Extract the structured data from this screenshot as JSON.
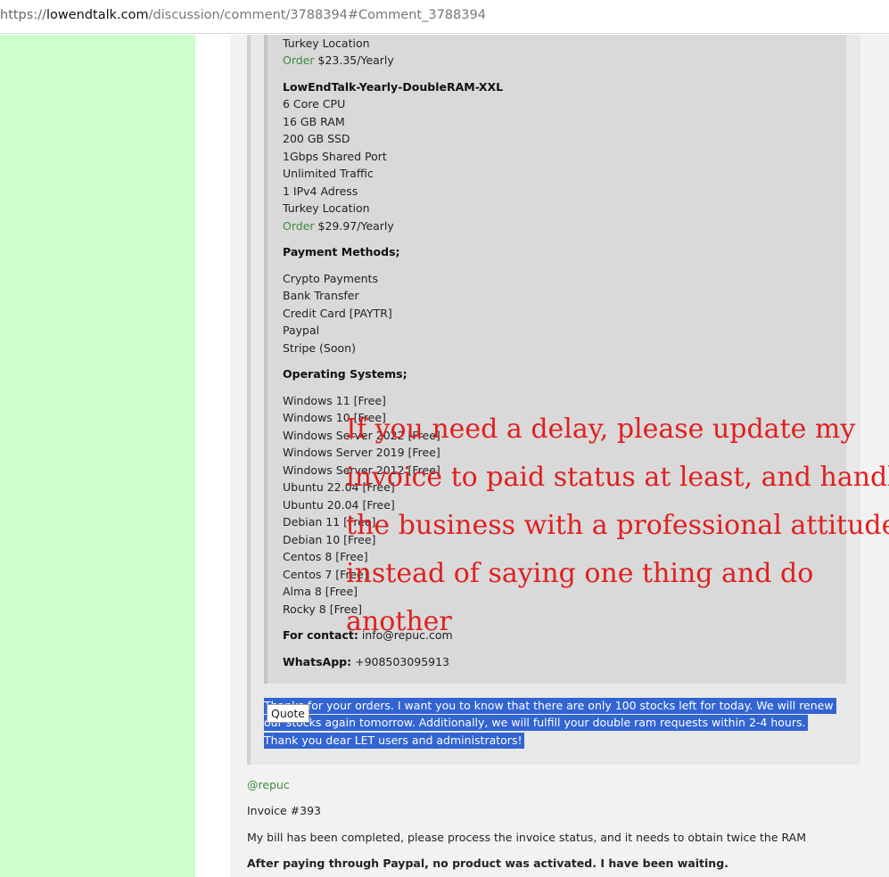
{
  "browser": {
    "url_scheme": "https://",
    "url_host": "lowendtalk.com",
    "url_path": "/discussion/comment/3788394#Comment_3788394"
  },
  "plan_prev": {
    "location": "Turkey Location",
    "order_label": "Order",
    "price": "$23.35/Yearly"
  },
  "plan_xxl": {
    "name": "LowEndTalk-Yearly-DoubleRAM-XXL",
    "specs": [
      "6 Core CPU",
      "16 GB RAM",
      "200 GB SSD",
      "1Gbps Shared Port",
      "Unlimited Traffic",
      "1 IPv4 Adress",
      "Turkey Location"
    ],
    "order_label": "Order",
    "price": "$29.97/Yearly"
  },
  "payment": {
    "heading": "Payment Methods;",
    "items": [
      "Crypto Payments",
      "Bank Transfer",
      "Credit Card [PAYTR]",
      "Paypal",
      "Stripe (Soon)"
    ]
  },
  "os": {
    "heading": "Operating Systems;",
    "items": [
      "Windows 11 [Free]",
      "Windows 10 [Free]",
      "Windows Server 2022 [Free]",
      "Windows Server 2019 [Free]",
      "Windows Server 2012 [Free]",
      "Ubuntu 22.04 [Free]",
      "Ubuntu 20.04 [Free]",
      "Debian 11 [Free]",
      "Debian 10 [Free]",
      "Centos 8 [Free]",
      "Centos 7 [Free]",
      "Alma 8 [Free]",
      "Rocky 8 [Free]"
    ]
  },
  "contact": {
    "label": "For contact:",
    "value": "info@repuc.com",
    "whatsapp_label": "WhatsApp:",
    "whatsapp_value": "+908503095913"
  },
  "selected_text": {
    "line1": "Thanks for your orders. I want you to know that there are only 100 stocks left for today. We will renew",
    "line2": "our stocks again tomorrow. Additionally, we will fulfill your double ram requests within 2-4 hours.",
    "line3": "Thank you dear LET users and administrators!"
  },
  "quote_button": "Quote",
  "reply": {
    "mention": "@repuc",
    "invoice": "Invoice #393",
    "body": "My bill has been completed, please process the invoice status, and it needs to obtain twice the RAM",
    "bold_line": "After paying through Paypal, no product was activated. I have been waiting."
  },
  "annotation": {
    "lines": [
      "If you need a delay, please update my",
      "invoice to paid status at least, and handle",
      "the business with a professional attitude",
      "instead of saying one thing and do",
      "another"
    ],
    "color": "#e02020"
  },
  "colors": {
    "side_panel": "#ccffcc",
    "selection": "#3264d2",
    "order_link": "#3e8a3e"
  }
}
